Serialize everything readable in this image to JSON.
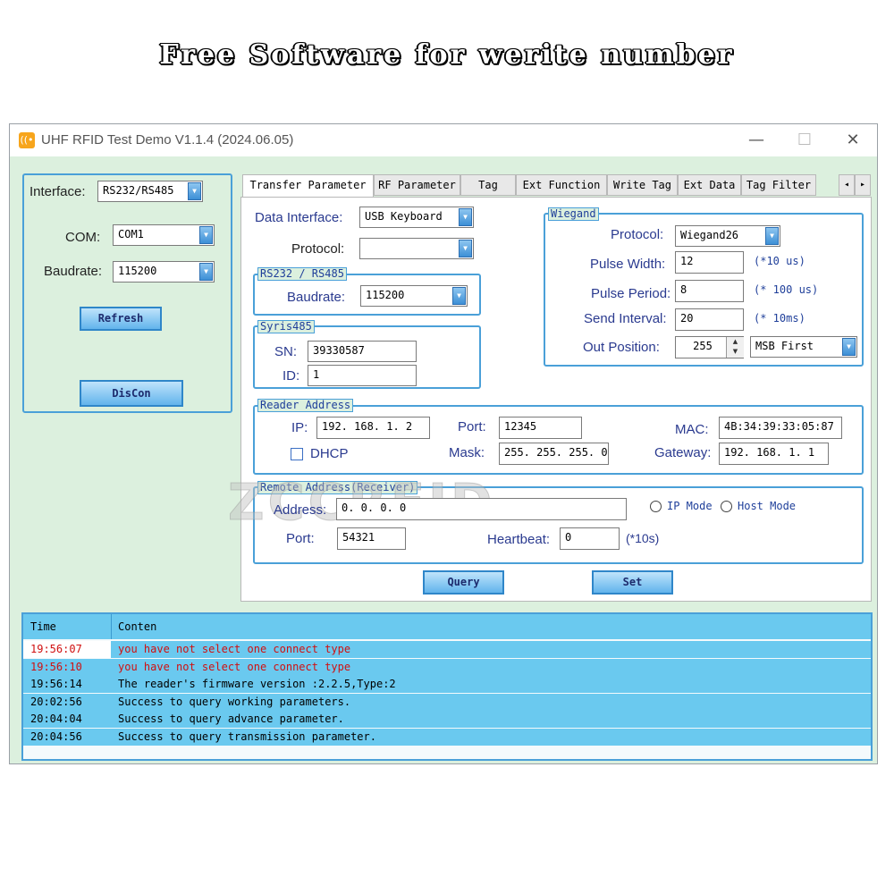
{
  "banner": "Free Software for werite number",
  "window": {
    "title": "UHF RFID Test Demo V1.1.4  (2024.06.05)",
    "minimize": "—",
    "maximize": "☐",
    "close": "✕"
  },
  "connection": {
    "interface_label": "Interface:",
    "interface_value": "RS232/RS485",
    "com_label": "COM:",
    "com_value": "COM1",
    "baudrate_label": "Baudrate:",
    "baudrate_value": "115200",
    "refresh": "Refresh",
    "discon": "DisCon"
  },
  "tabs": [
    "Transfer Parameter",
    "RF Parameter",
    "Tag",
    "Ext Function",
    "Write Tag",
    "Ext Data",
    "Tag Filter"
  ],
  "tab_scroll": {
    "left": "◂",
    "right": "▸"
  },
  "transfer": {
    "data_interface_label": "Data Interface:",
    "data_interface_value": "USB Keyboard",
    "protocol_label": "Protocol:",
    "protocol_value": "",
    "rs_group": "RS232 / RS485",
    "rs_baudrate_label": "Baudrate:",
    "rs_baudrate_value": "115200",
    "syris_group": "Syris485",
    "sn_label": "SN:",
    "sn_value": "39330587",
    "id_label": "ID:",
    "id_value": "1"
  },
  "wiegand": {
    "group": "Wiegand",
    "protocol_label": "Protocol:",
    "protocol_value": "Wiegand26",
    "pulse_width_label": "Pulse Width:",
    "pulse_width_value": "12",
    "pulse_width_unit": "(*10 us)",
    "pulse_period_label": "Pulse Period:",
    "pulse_period_value": "8",
    "pulse_period_unit": "(* 100 us)",
    "send_interval_label": "Send Interval:",
    "send_interval_value": "20",
    "send_interval_unit": "(* 10ms)",
    "out_position_label": "Out Position:",
    "out_position_value": "255",
    "bit_order": "MSB First"
  },
  "reader": {
    "group": "Reader Address",
    "ip_label": "IP:",
    "ip_value": "192. 168. 1. 2",
    "port_label": "Port:",
    "port_value": "12345",
    "mac_label": "MAC:",
    "mac_value": "4B:34:39:33:05:87",
    "dhcp_label": "DHCP",
    "mask_label": "Mask:",
    "mask_value": "255. 255. 255. 0",
    "gateway_label": "Gateway:",
    "gateway_value": "192. 168. 1. 1"
  },
  "remote": {
    "group": "Remote Address(Receiver)",
    "address_label": "Address:",
    "address_value": "0. 0. 0. 0",
    "ip_mode": "IP Mode",
    "host_mode": "Host Mode",
    "port_label": "Port:",
    "port_value": "54321",
    "heartbeat_label": "Heartbeat:",
    "heartbeat_value": "0",
    "heartbeat_unit": "(*10s)"
  },
  "actions": {
    "query": "Query",
    "set": "Set"
  },
  "watermark": "ZCCRFID",
  "log": {
    "col_time": "Time",
    "col_content": "Conten",
    "rows": [
      {
        "time": "19:56:07",
        "content": "you have not select one connect type",
        "status": "error"
      },
      {
        "time": "19:56:10",
        "content": "you have not select one connect type",
        "status": "error"
      },
      {
        "time": "19:56:14",
        "content": "The reader's firmware version :2.2.5,Type:2",
        "status": "info"
      },
      {
        "time": "20:02:56",
        "content": "Success to query working parameters.",
        "status": "info"
      },
      {
        "time": "20:04:04",
        "content": "Success to query advance parameter.",
        "status": "info"
      },
      {
        "time": "20:04:56",
        "content": "Success to query transmission parameter.",
        "status": "info"
      }
    ]
  },
  "colors": {
    "error_text": "#d01010",
    "log_row_bg": "#6ac9ef",
    "accent": "#4aa0d8"
  }
}
